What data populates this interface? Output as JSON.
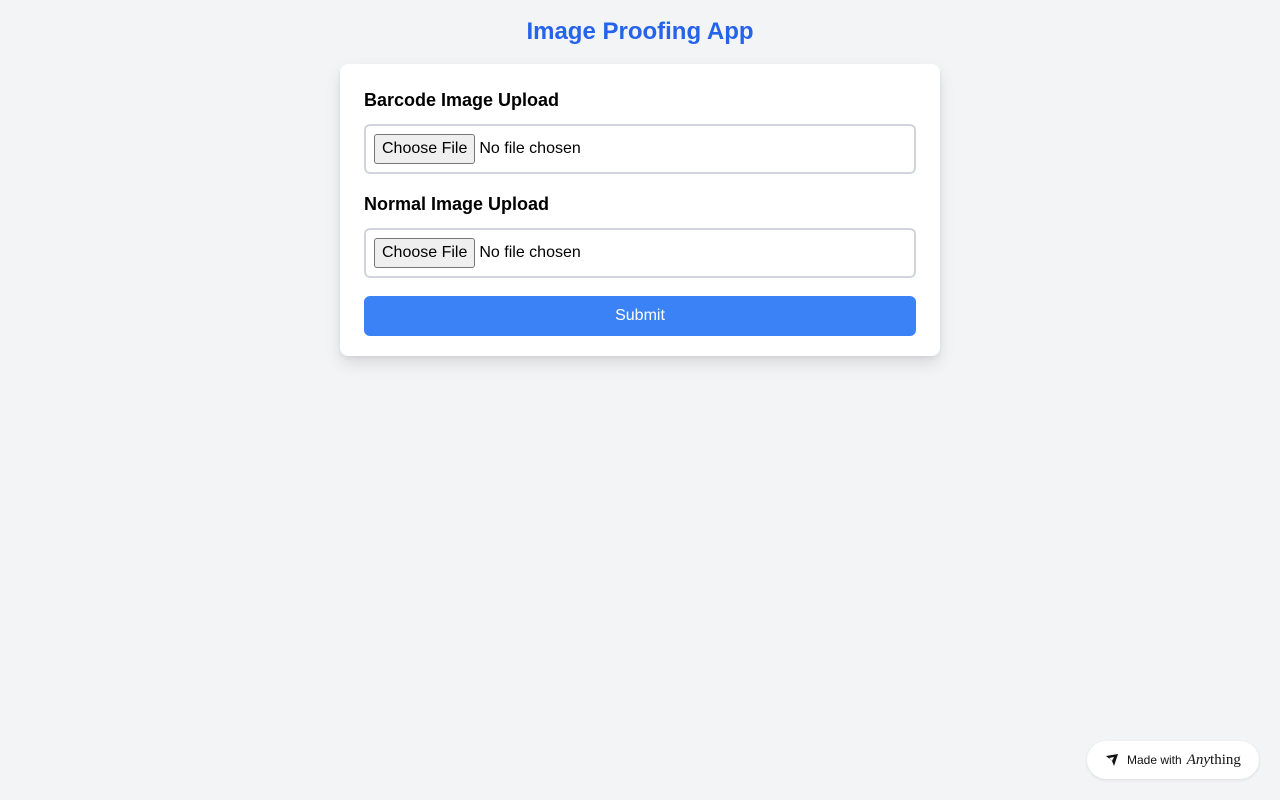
{
  "app": {
    "title": "Image Proofing App",
    "accent_color": "#2563eb",
    "button_color": "#3b82f6"
  },
  "form": {
    "barcode": {
      "label": "Barcode Image Upload",
      "button_label": "Choose File",
      "status": "No file chosen"
    },
    "normal": {
      "label": "Normal Image Upload",
      "button_label": "Choose File",
      "status": "No file chosen"
    },
    "submit_label": "Submit"
  },
  "badge": {
    "made_with": "Made with",
    "brand_italic": "Any",
    "brand_rest": "thing",
    "logo_icon": "anything-logo-icon"
  }
}
